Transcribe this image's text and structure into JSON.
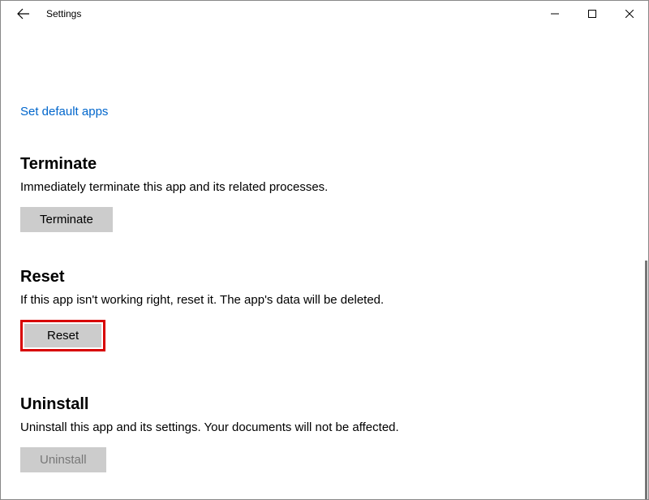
{
  "window": {
    "title": "Settings"
  },
  "link": {
    "default_apps": "Set default apps"
  },
  "sections": {
    "terminate": {
      "heading": "Terminate",
      "description": "Immediately terminate this app and its related processes.",
      "button_label": "Terminate"
    },
    "reset": {
      "heading": "Reset",
      "description": "If this app isn't working right, reset it. The app's data will be deleted.",
      "button_label": "Reset"
    },
    "uninstall": {
      "heading": "Uninstall",
      "description": "Uninstall this app and its settings. Your documents will not be affected.",
      "button_label": "Uninstall"
    }
  }
}
